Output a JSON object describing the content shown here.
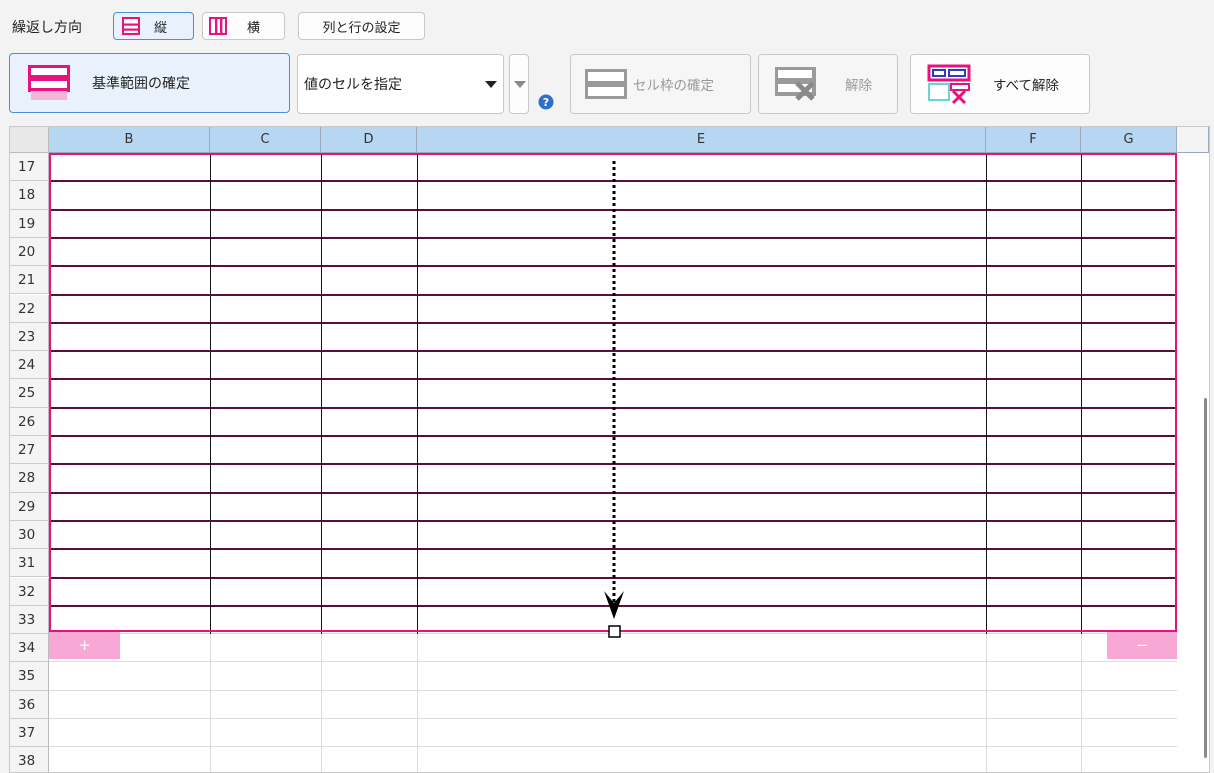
{
  "toolbar_top": {
    "direction_label": "繰返し方向",
    "vertical_label": "縦",
    "horizontal_label": "横",
    "colrow_settings_label": "列と行の設定"
  },
  "toolbar_main": {
    "confirm_base_range_label": "基準範囲の確定",
    "value_cell_select": "値のセルを指定",
    "confirm_cell_frame_label": "セル枠の確定",
    "release_label": "解除",
    "release_all_label": "すべて解除"
  },
  "sheet": {
    "columns": [
      "B",
      "C",
      "D",
      "E",
      "F",
      "G"
    ],
    "rows": [
      "17",
      "18",
      "19",
      "20",
      "21",
      "22",
      "23",
      "24",
      "25",
      "26",
      "27",
      "28",
      "29",
      "30",
      "31",
      "32",
      "33",
      "34",
      "35",
      "36",
      "37",
      "38"
    ],
    "add_tab": "+",
    "remove_tab": "−"
  },
  "colors": {
    "accent_pink": "#e8127e",
    "header_blue": "#b6d6f2",
    "tab_pink": "#f7a8d4"
  }
}
